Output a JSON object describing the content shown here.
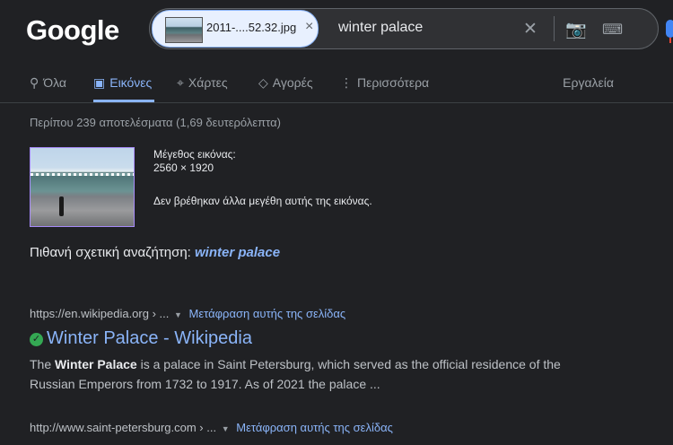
{
  "logo": "Google",
  "search": {
    "chip_filename": "2011-....52.32.jpg",
    "chip_close": "×",
    "query": "winter palace"
  },
  "icons": {
    "clear": "✕",
    "camera": "📷",
    "keyboard": "⌨"
  },
  "tabs": [
    {
      "label": "Όλα",
      "icon": "search-icon",
      "glyph": "⚲"
    },
    {
      "label": "Εικόνες",
      "icon": "images-icon",
      "glyph": "▣"
    },
    {
      "label": "Χάρτες",
      "icon": "map-pin-icon",
      "glyph": "⌖"
    },
    {
      "label": "Αγορές",
      "icon": "tag-icon",
      "glyph": "◇"
    },
    {
      "label": "Περισσότερα",
      "icon": "more-vert-icon",
      "glyph": "⋮"
    }
  ],
  "tools_label": "Εργαλεία",
  "result_count": "Περίπου 239 αποτελέσματα (1,69 δευτερόλεπτα)",
  "image_info": {
    "size_label": "Μέγεθος εικόνας:",
    "size_value": "2560 × 1920",
    "no_other_sizes": "Δεν βρέθηκαν άλλα μεγέθη αυτής της εικόνας."
  },
  "related_search": {
    "label": "Πιθανή σχετική αναζήτηση:",
    "query": "winter palace"
  },
  "results": [
    {
      "url": "https://en.wikipedia.org › ...",
      "translate": "Μετάφραση αυτής της σελίδας",
      "title": "Winter Palace - Wikipedia",
      "snippet_pre": "The ",
      "snippet_bold": "Winter Palace",
      "snippet_post": " is a palace in Saint Petersburg, which served as the official residence of the Russian Emperors from 1732 to 1917. As of 2021 the palace ..."
    },
    {
      "url": "http://www.saint-petersburg.com › ...",
      "translate": "Μετάφραση αυτής της σελίδας"
    }
  ],
  "colors": {
    "background": "#202124",
    "link": "#8ab4f8",
    "verified": "#34a853"
  }
}
